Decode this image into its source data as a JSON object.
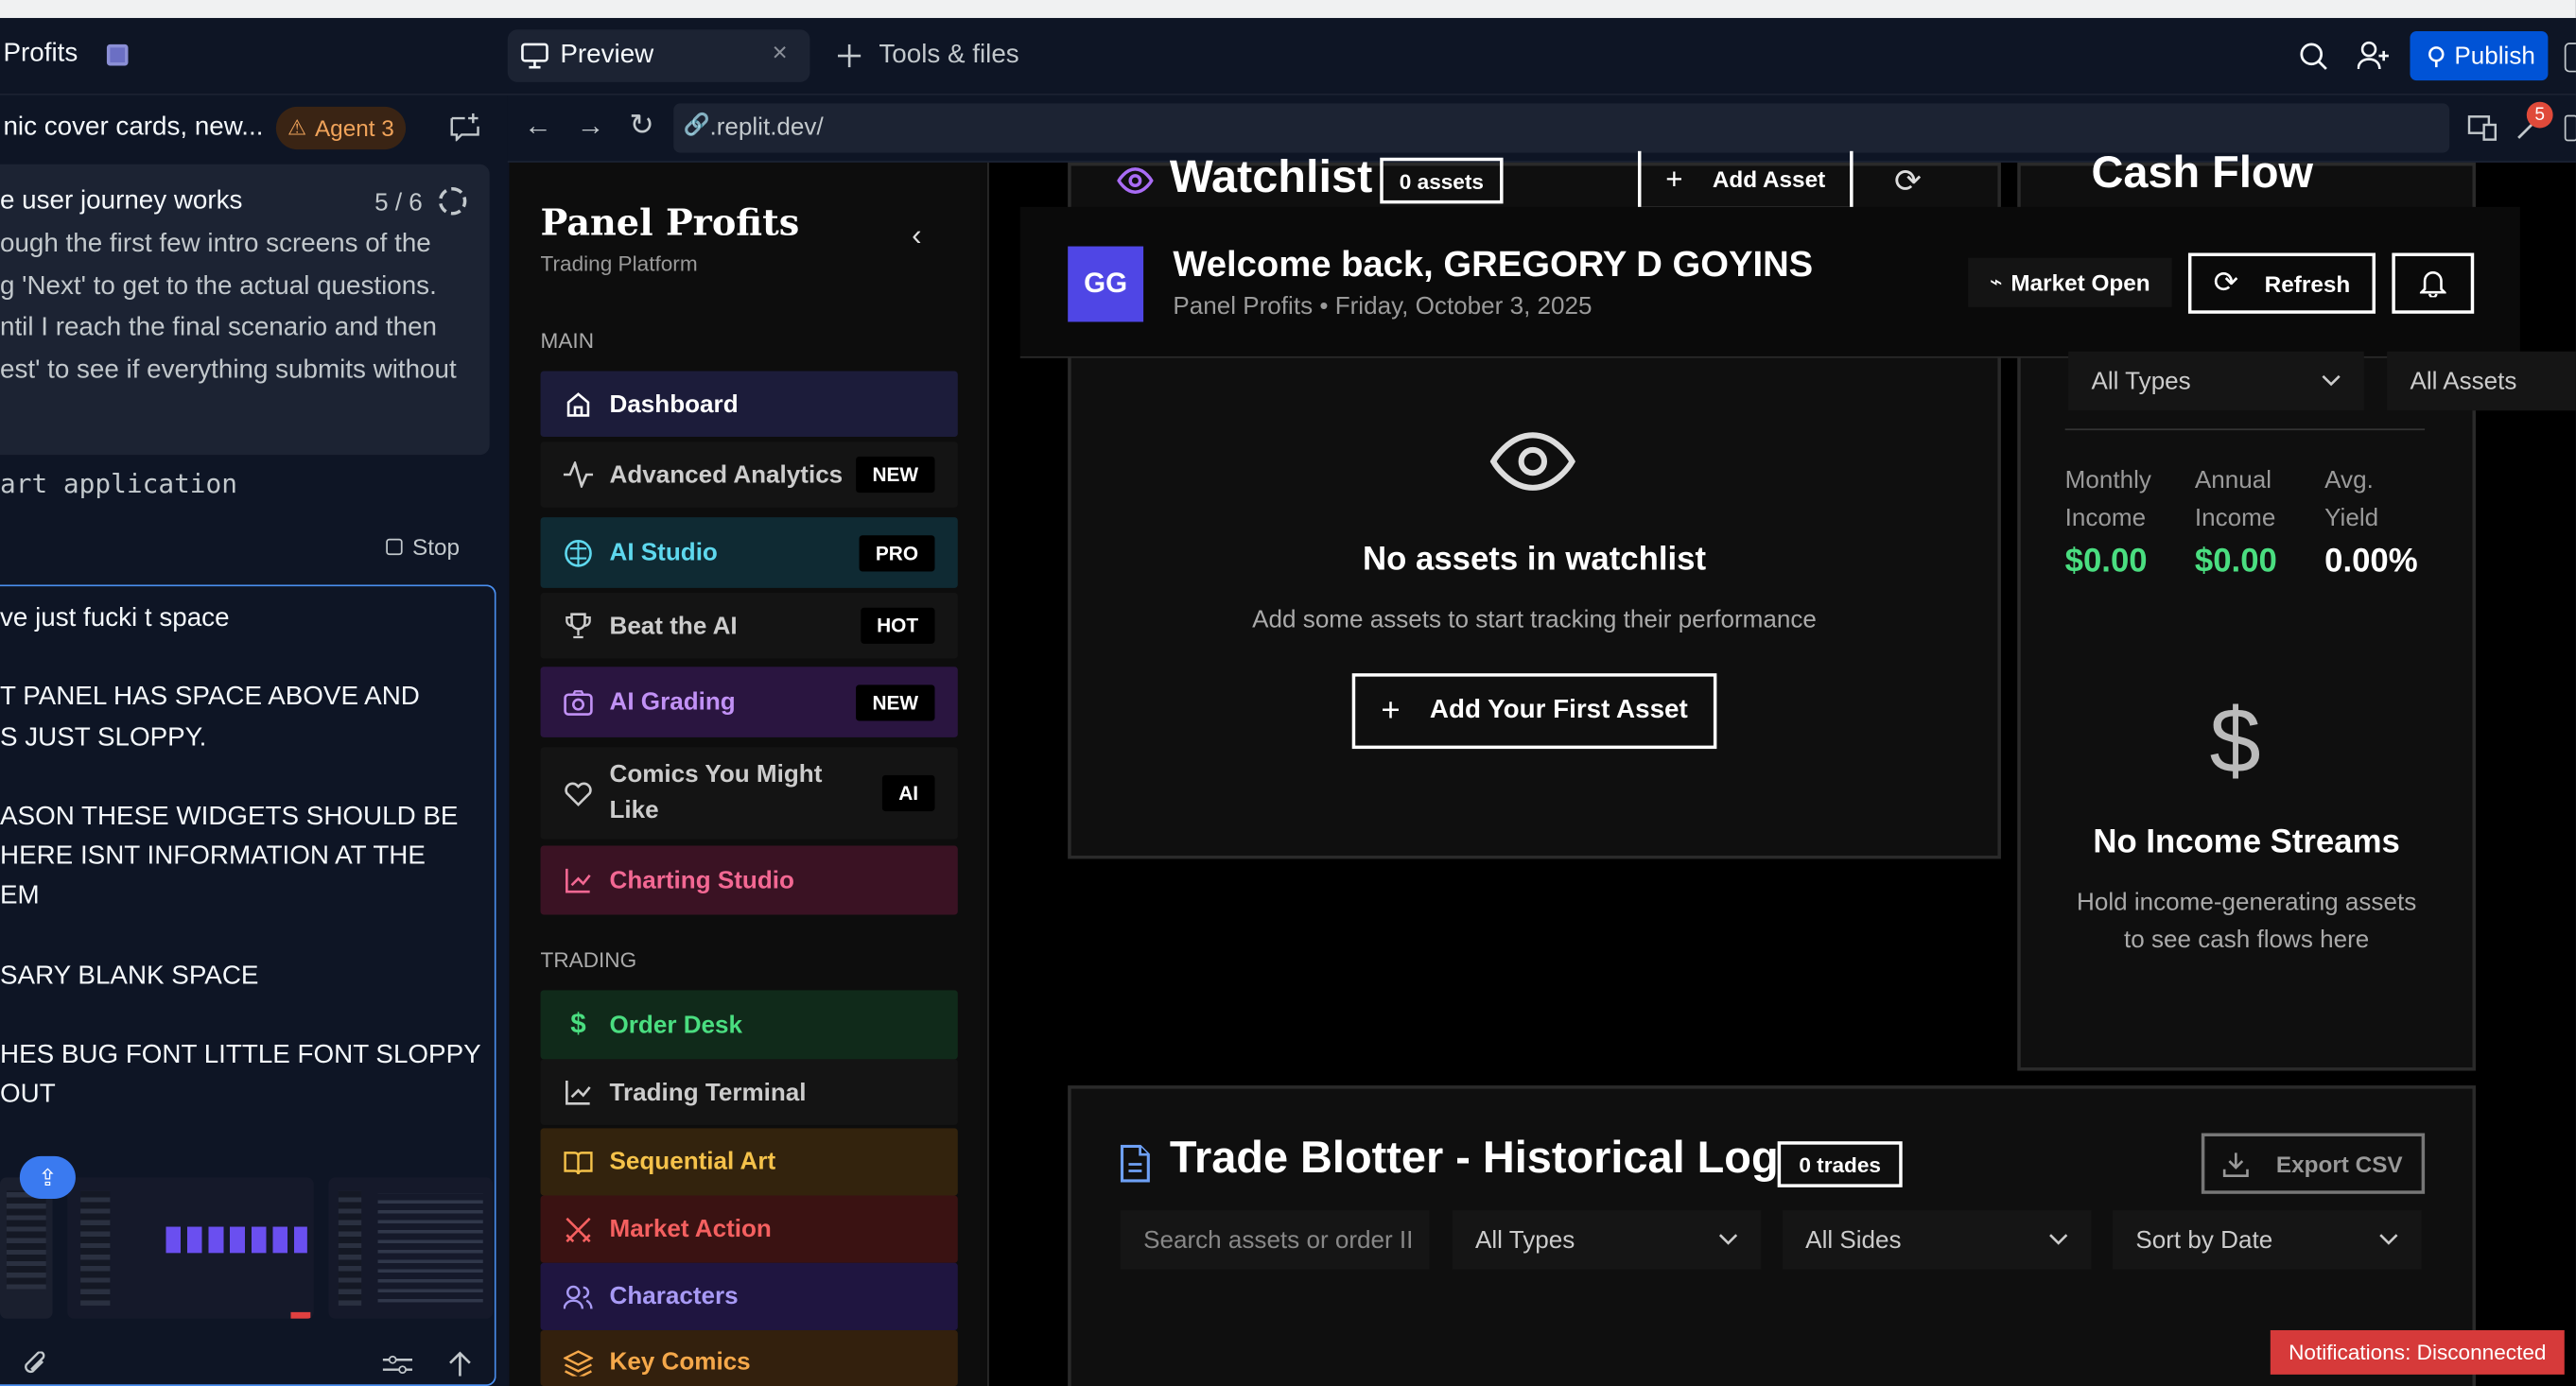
{
  "workspace": {
    "project_title": "Profits",
    "session_title": "nic cover cards, new...",
    "agent_label": "Agent 3",
    "task_text": "e user journey works",
    "task_progress": "5 / 6",
    "task_lines": [
      "ough the first few intro screens of the",
      "g 'Next' to get to the actual questions.",
      "ntil I reach the final scenario and then",
      "est' to see if everything submits without"
    ],
    "code_line": "art application",
    "stop_label": "Stop",
    "chat_lines": [
      "ve just fucki t space",
      "",
      "T PANEL HAS SPACE ABOVE AND",
      "S JUST SLOPPY.",
      "",
      "ASON THESE WIDGETS SHOULD BE",
      "HERE ISNT INFORMATION AT THE",
      "EM",
      "",
      "SARY BLANK SPACE",
      "",
      "HES BUG FONT LITTLE FONT SLOPPY",
      "OUT"
    ]
  },
  "tabs": {
    "preview_label": "Preview",
    "tools_label": "Tools & files",
    "publish_label": "Publish",
    "notif_count": "5"
  },
  "url": {
    "address": ".replit.dev/"
  },
  "sidebar": {
    "brand": "Panel Profits",
    "tagline": "Trading Platform",
    "section_main": "MAIN",
    "section_trading": "TRADING",
    "main_items": [
      {
        "label": "Dashboard",
        "badge": ""
      },
      {
        "label": "Advanced Analytics",
        "badge": "NEW"
      },
      {
        "label": "AI Studio",
        "badge": "PRO"
      },
      {
        "label": "Beat the AI",
        "badge": "HOT"
      },
      {
        "label": "AI Grading",
        "badge": "NEW"
      },
      {
        "label": "Comics You Might Like",
        "badge": "AI"
      },
      {
        "label": "Charting Studio",
        "badge": ""
      }
    ],
    "trading_items": [
      {
        "label": "Order Desk"
      },
      {
        "label": "Trading Terminal"
      },
      {
        "label": "Sequential Art"
      },
      {
        "label": "Market Action"
      },
      {
        "label": "Characters"
      },
      {
        "label": "Key Comics"
      }
    ]
  },
  "header": {
    "avatar_initials": "GG",
    "welcome": "Welcome back, GREGORY D GOYINS",
    "subline": "Panel Profits • Friday, October 3, 2025",
    "market_status": "Market Open",
    "refresh_label": "Refresh"
  },
  "watchlist": {
    "title": "Watchlist",
    "count": "0 assets",
    "add_label": "Add Asset",
    "empty_title": "No assets in watchlist",
    "empty_sub": "Add some assets to start tracking their performance",
    "cta": "Add Your First Asset"
  },
  "cashflow": {
    "title": "Cash Flow",
    "type_filter": "All Types",
    "asset_filter": "All Assets",
    "stats": [
      {
        "label": [
          "Monthly",
          "Income"
        ],
        "value": "$0.00"
      },
      {
        "label": [
          "Annual",
          "Income"
        ],
        "value": "$0.00"
      },
      {
        "label": [
          "Avg.",
          "Yield"
        ],
        "value": "0.00%"
      }
    ],
    "empty_title": "No Income Streams",
    "empty_sub": [
      "Hold income-generating assets",
      "to see cash flows here"
    ]
  },
  "blotter": {
    "title": "Trade Blotter - Historical Log",
    "count": "0 trades",
    "export_label": "Export CSV",
    "search_placeholder": "Search assets or order II",
    "type_filter": "All Types",
    "side_filter": "All Sides",
    "sort_filter": "Sort by Date"
  },
  "toast": "Notifications: Disconnected",
  "colors": {
    "brand_publish": "#0053d6",
    "avatar": "#4f46e5",
    "positive": "#4ade80"
  }
}
